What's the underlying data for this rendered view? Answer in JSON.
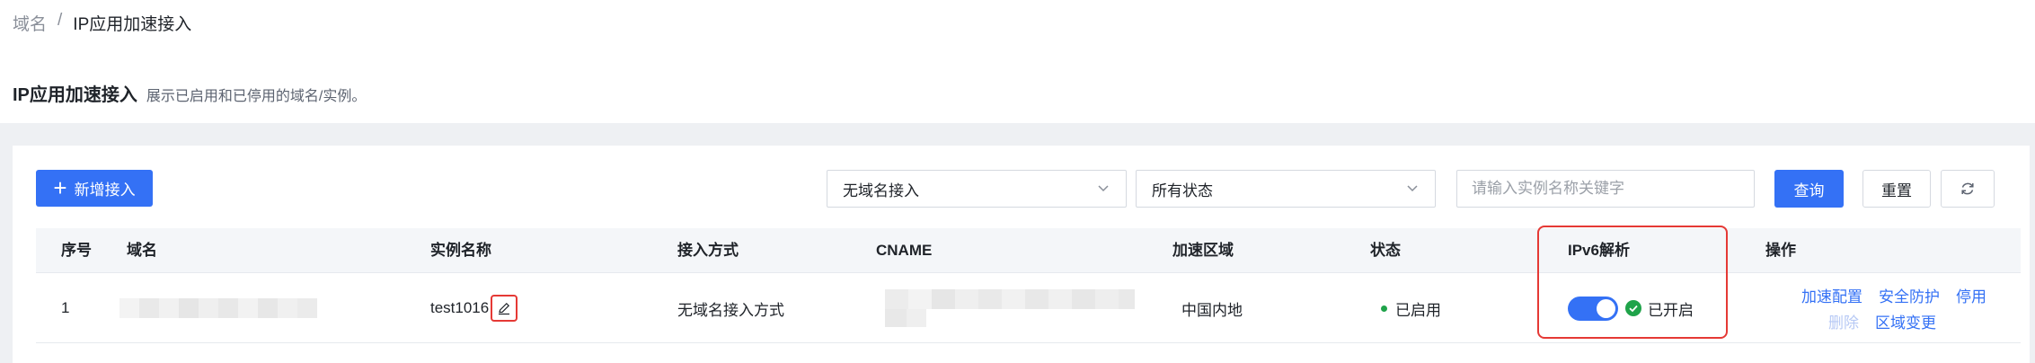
{
  "breadcrumb": {
    "parent": "域名",
    "separator": "/",
    "current": "IP应用加速接入"
  },
  "page": {
    "title": "IP应用加速接入",
    "description": "展示已启用和已停用的域名/实例。"
  },
  "toolbar": {
    "add_label": "新增接入",
    "access_filter": "无域名接入",
    "status_filter": "所有状态",
    "search_placeholder": "请输入实例名称关键字",
    "search_value": "",
    "query_label": "查询",
    "reset_label": "重置"
  },
  "table": {
    "columns": {
      "index": "序号",
      "domain": "域名",
      "instance": "实例名称",
      "access": "接入方式",
      "cname": "CNAME",
      "region": "加速区域",
      "status": "状态",
      "ipv6": "IPv6解析",
      "actions": "操作"
    },
    "rows": [
      {
        "index": "1",
        "instance": "test1016",
        "access": "无域名接入方式",
        "region": "中国内地",
        "status": "已启用",
        "ipv6_status": "已开启",
        "actions": {
          "config": "加速配置",
          "security": "安全防护",
          "disable": "停用",
          "delete": "删除",
          "region_change": "区域变更"
        }
      }
    ]
  },
  "colors": {
    "primary": "#3471f5",
    "success": "#1fa34a",
    "highlight": "#e53935",
    "disabled_link": "#b7c9f5"
  },
  "icons": [
    "plus-icon",
    "chevron-down-icon",
    "refresh-icon",
    "edit-icon",
    "check-circle-icon"
  ]
}
